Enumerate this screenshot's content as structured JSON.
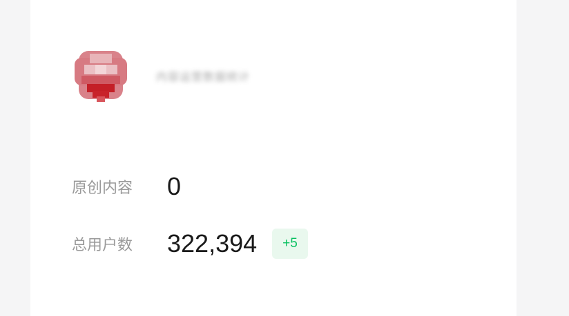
{
  "account": {
    "name": "内容运营数据统计",
    "avatar_icon": "red-shield-logo-icon",
    "avatar_color": "#c8323a"
  },
  "stats": {
    "original_content": {
      "label": "原创内容",
      "value": "0"
    },
    "total_users": {
      "label": "总用户数",
      "value": "322,394",
      "delta": "+5"
    }
  },
  "colors": {
    "page_background": "#f5f5f6",
    "card_background": "#ffffff",
    "label": "#9a9a9a",
    "value": "#191919",
    "delta_text": "#07c160",
    "delta_background": "#e9f8ee"
  }
}
